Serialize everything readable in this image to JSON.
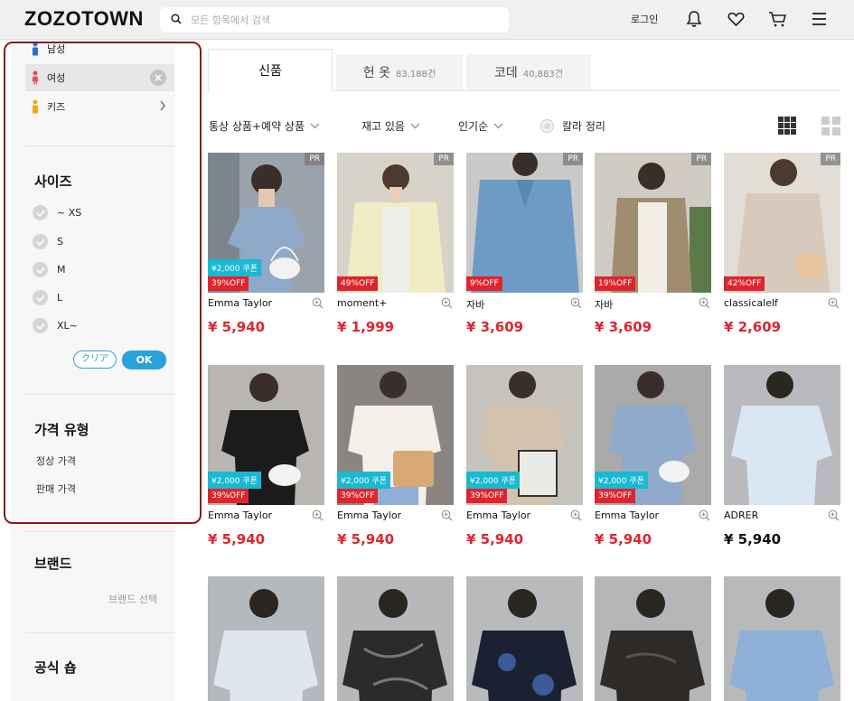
{
  "header": {
    "logo": "ZOZOTOWN",
    "search_placeholder": "모든 항목에서 검색",
    "login": "로그인"
  },
  "sidebar": {
    "genders": [
      {
        "label": "남성",
        "color": "#2a6fd6"
      },
      {
        "label": "여성",
        "color": "#e0505a"
      },
      {
        "label": "키즈",
        "color": "#f0a818"
      }
    ],
    "size_title": "사이즈",
    "sizes": [
      "~ XS",
      "S",
      "M",
      "L",
      "XL~"
    ],
    "clear_label": "クリア",
    "ok_label": "OK",
    "price_title": "가격 유형",
    "price_types": [
      "정상 가격",
      "판매 가격"
    ],
    "brand_title": "브랜드",
    "brand_select": "브랜드 선택",
    "shop_title": "공식 숍"
  },
  "tabs": [
    {
      "label": "신품",
      "count": ""
    },
    {
      "label": "헌 옷",
      "count": "83,188건"
    },
    {
      "label": "코데",
      "count": "40,883건"
    }
  ],
  "filters": {
    "type": "통상 상품+예약 상품",
    "stock": "재고 있음",
    "sort": "인기순",
    "color_sort": "칼라 정리"
  },
  "badges": {
    "pr": "PR"
  },
  "products": [
    {
      "name": "Emma Taylor",
      "price": "¥ 5,940",
      "off": "39%OFF",
      "coupon": "¥2,000 쿠폰",
      "pr": true,
      "sale": true
    },
    {
      "name": "moment+",
      "price": "¥ 1,999",
      "off": "49%OFF",
      "coupon": "",
      "pr": true,
      "sale": true
    },
    {
      "name": "자바",
      "price": "¥ 3,609",
      "off": "9%OFF",
      "coupon": "",
      "pr": true,
      "sale": true
    },
    {
      "name": "자바",
      "price": "¥ 3,609",
      "off": "19%OFF",
      "coupon": "",
      "pr": true,
      "sale": true
    },
    {
      "name": "classicalelf",
      "price": "¥ 2,609",
      "off": "42%OFF",
      "coupon": "",
      "pr": true,
      "sale": true
    },
    {
      "name": "Emma Taylor",
      "price": "¥ 5,940",
      "off": "39%OFF",
      "coupon": "¥2,000 쿠폰",
      "pr": false,
      "sale": true
    },
    {
      "name": "Emma Taylor",
      "price": "¥ 5,940",
      "off": "39%OFF",
      "coupon": "¥2,000 쿠폰",
      "pr": false,
      "sale": true
    },
    {
      "name": "Emma Taylor",
      "price": "¥ 5,940",
      "off": "39%OFF",
      "coupon": "¥2,000 쿠폰",
      "pr": false,
      "sale": true
    },
    {
      "name": "Emma Taylor",
      "price": "¥ 5,940",
      "off": "39%OFF",
      "coupon": "¥2,000 쿠폰",
      "pr": false,
      "sale": true
    },
    {
      "name": "ADRER",
      "price": "¥ 5,940",
      "off": "",
      "coupon": "",
      "pr": false,
      "sale": false
    }
  ],
  "colors": {
    "accent": "#2aa3d9",
    "sale": "#e0242c",
    "coupon": "#19b9d2",
    "highlight": "#8b1a1a"
  },
  "icons": {
    "search": "search-icon",
    "bell": "bell-icon",
    "heart": "heart-icon",
    "cart": "cart-icon",
    "menu": "menu-icon",
    "zoom": "zoom-icon"
  }
}
